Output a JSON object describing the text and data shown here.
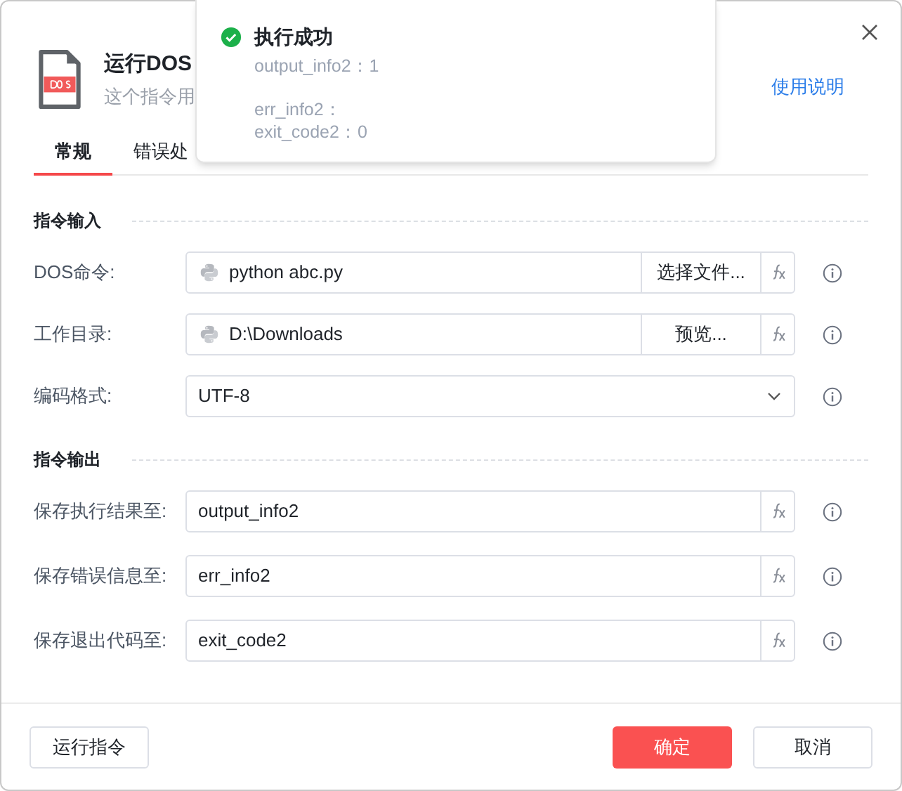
{
  "dialog": {
    "title": "运行DOS",
    "subtitle": "这个指令用",
    "help_link": "使用说明"
  },
  "tabs": [
    {
      "label": "常规",
      "selected": true
    },
    {
      "label": "错误处",
      "selected": false
    }
  ],
  "sections": [
    {
      "title": "指令输入",
      "rows": [
        {
          "kind": "file",
          "label": "DOS命令:",
          "value": "python abc.py",
          "button": "选择文件..."
        },
        {
          "kind": "file",
          "label": "工作目录:",
          "value": "D:\\Downloads",
          "button": "预览..."
        },
        {
          "kind": "select",
          "label": "编码格式:",
          "value": "UTF-8"
        }
      ]
    },
    {
      "title": "指令输出",
      "rows": [
        {
          "kind": "variable",
          "label": "保存执行结果至:",
          "value": "output_info2"
        },
        {
          "kind": "variable",
          "label": "保存错误信息至:",
          "value": "err_info2"
        },
        {
          "kind": "variable",
          "label": "保存退出代码至:",
          "value": "exit_code2"
        }
      ]
    }
  ],
  "footer": {
    "run_button": "运行指令",
    "confirm_button": "确定",
    "cancel_button": "取消"
  },
  "toast": {
    "title": "执行成功",
    "groups": [
      [
        "output_info2：1"
      ],
      [
        "err_info2：",
        "exit_code2：0"
      ]
    ]
  }
}
